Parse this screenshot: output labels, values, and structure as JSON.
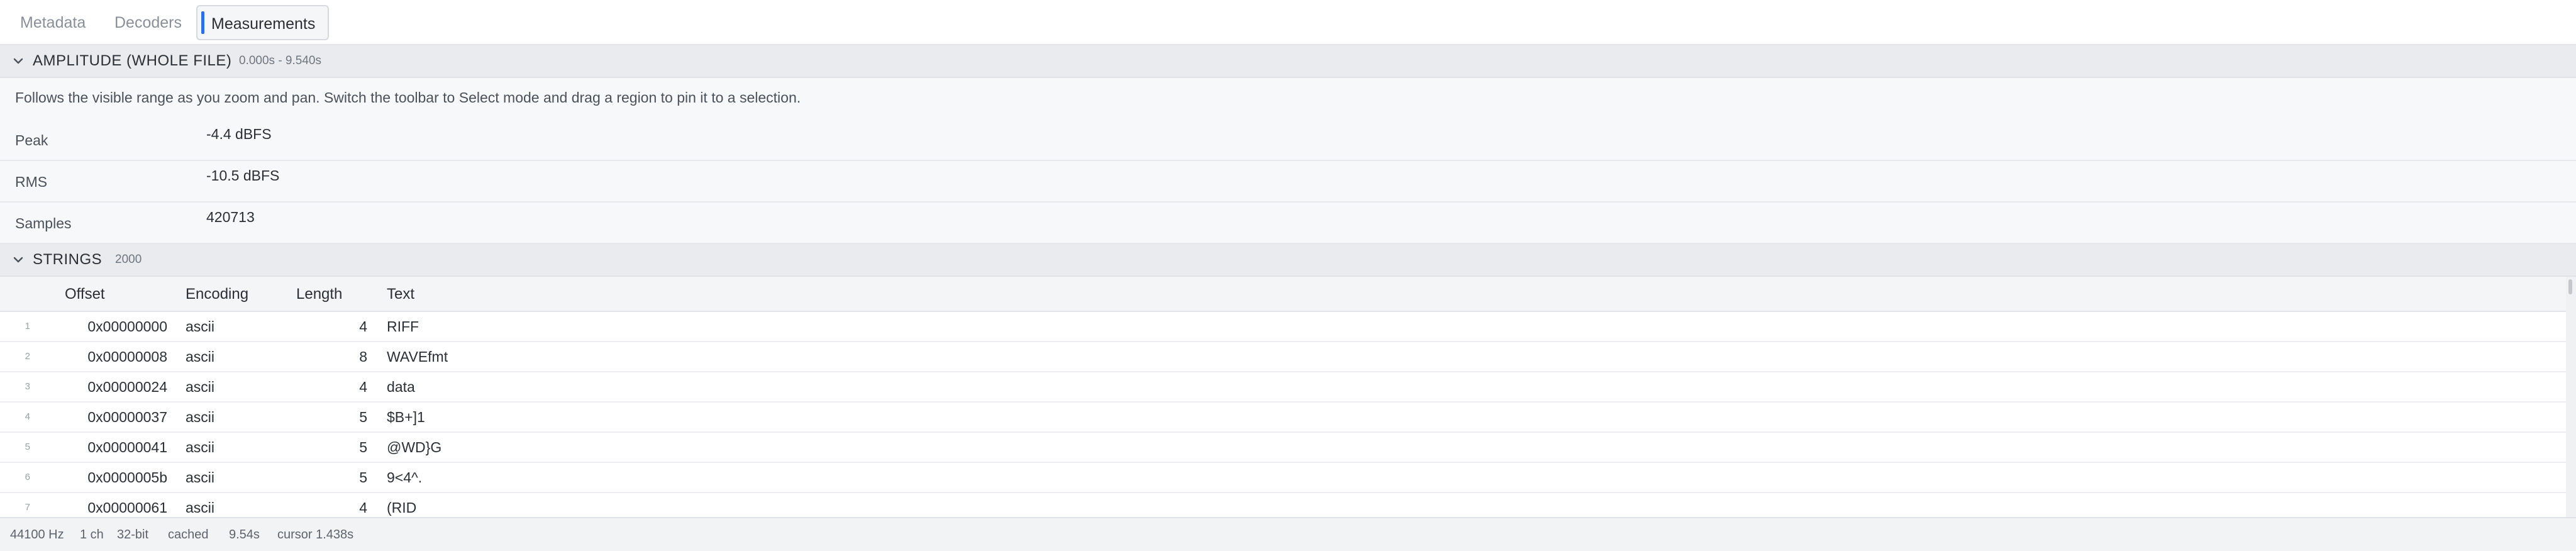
{
  "tabs": [
    {
      "label": "Metadata",
      "active": false
    },
    {
      "label": "Decoders",
      "active": false
    },
    {
      "label": "Measurements",
      "active": true
    }
  ],
  "amplitude": {
    "title": "AMPLITUDE (WHOLE FILE)",
    "range": "0.000s - 9.540s",
    "hint": "Follows the visible range as you zoom and pan. Switch the toolbar to Select mode and drag a region to pin it to a selection.",
    "rows": [
      {
        "label": "Peak",
        "value": "-4.4 dBFS"
      },
      {
        "label": "RMS",
        "value": "-10.5 dBFS"
      },
      {
        "label": "Samples",
        "value": "420713"
      }
    ]
  },
  "strings": {
    "title": "STRINGS",
    "count": "2000",
    "columns": [
      "Offset",
      "Encoding",
      "Length",
      "Text"
    ],
    "rows": [
      {
        "index": "1",
        "offset": "0x00000000",
        "encoding": "ascii",
        "length": "4",
        "text": "RIFF"
      },
      {
        "index": "2",
        "offset": "0x00000008",
        "encoding": "ascii",
        "length": "8",
        "text": "WAVEfmt"
      },
      {
        "index": "3",
        "offset": "0x00000024",
        "encoding": "ascii",
        "length": "4",
        "text": "data"
      },
      {
        "index": "4",
        "offset": "0x00000037",
        "encoding": "ascii",
        "length": "5",
        "text": "$B+]1"
      },
      {
        "index": "5",
        "offset": "0x00000041",
        "encoding": "ascii",
        "length": "5",
        "text": "@WD}G"
      },
      {
        "index": "6",
        "offset": "0x0000005b",
        "encoding": "ascii",
        "length": "5",
        "text": "9<4^."
      },
      {
        "index": "7",
        "offset": "0x00000061",
        "encoding": "ascii",
        "length": "4",
        "text": "(RID"
      }
    ]
  },
  "status": {
    "sample_rate": "44100 Hz",
    "channels": "1 ch",
    "bit_depth": "32-bit",
    "cache": "cached",
    "duration": "9.54s",
    "cursor": "cursor 1.438s"
  },
  "icons": {
    "section_toggle": "chevron-down-icon"
  },
  "colors": {
    "accent": "#2f6fdc"
  }
}
